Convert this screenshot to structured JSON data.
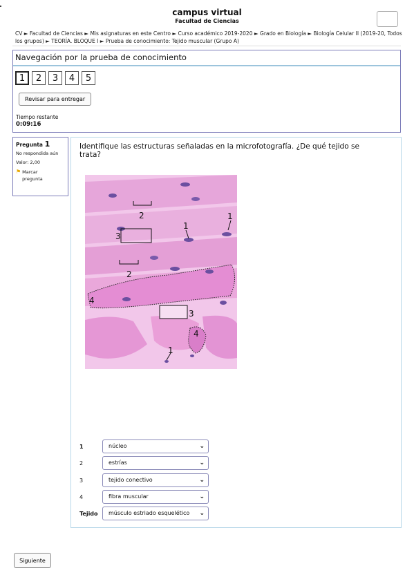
{
  "header": {
    "site_name": "campus virtual",
    "faculty": "Facultad de Ciencias"
  },
  "breadcrumb": "CV ► Facultad de Ciencias ► Mis asignaturas en este Centro ► Curso académico 2019-2020 ► Grado en Biología ► Biología Celular II (2019-20, Todos los grupos) ► TEORÍA. BLOQUE I ► Prueba de conocimiento: Tejido muscular (Grupo A)",
  "nav_panel": {
    "title": "Navegación por la prueba de conocimiento",
    "questions": [
      "1",
      "2",
      "3",
      "4",
      "5"
    ],
    "current": 0,
    "review_button": "Revisar para entregar",
    "time_label": "Tiempo restante",
    "time_value": "0:09:16"
  },
  "question_info": {
    "label": "Pregunta",
    "number": "1",
    "status": "No respondida aún",
    "value": "Valor: 2,00",
    "flag_text": "Marcar pregunta"
  },
  "question": {
    "text": "Identifique las estructuras señaladas en la microfotografía. ¿De qué tejido se trata?",
    "image_labels": [
      "2",
      "1",
      "1",
      "3",
      "2",
      "4",
      "3",
      "4",
      "1"
    ],
    "answers": [
      {
        "label": "1",
        "value": "núcleo"
      },
      {
        "label": "2",
        "value": "estrías"
      },
      {
        "label": "3",
        "value": "tejido conectivo"
      },
      {
        "label": "4",
        "value": "fibra muscular"
      },
      {
        "label": "Tejido",
        "value": "músculo estriado esquelético"
      }
    ]
  },
  "next_button": "Siguiente",
  "colors": {
    "panel_border": "#7a7ab8",
    "content_border": "#b7d7e9",
    "flag": "#e8a800",
    "tissue_pink": "#e9a6d8",
    "nucleus": "#6b4fa0"
  }
}
